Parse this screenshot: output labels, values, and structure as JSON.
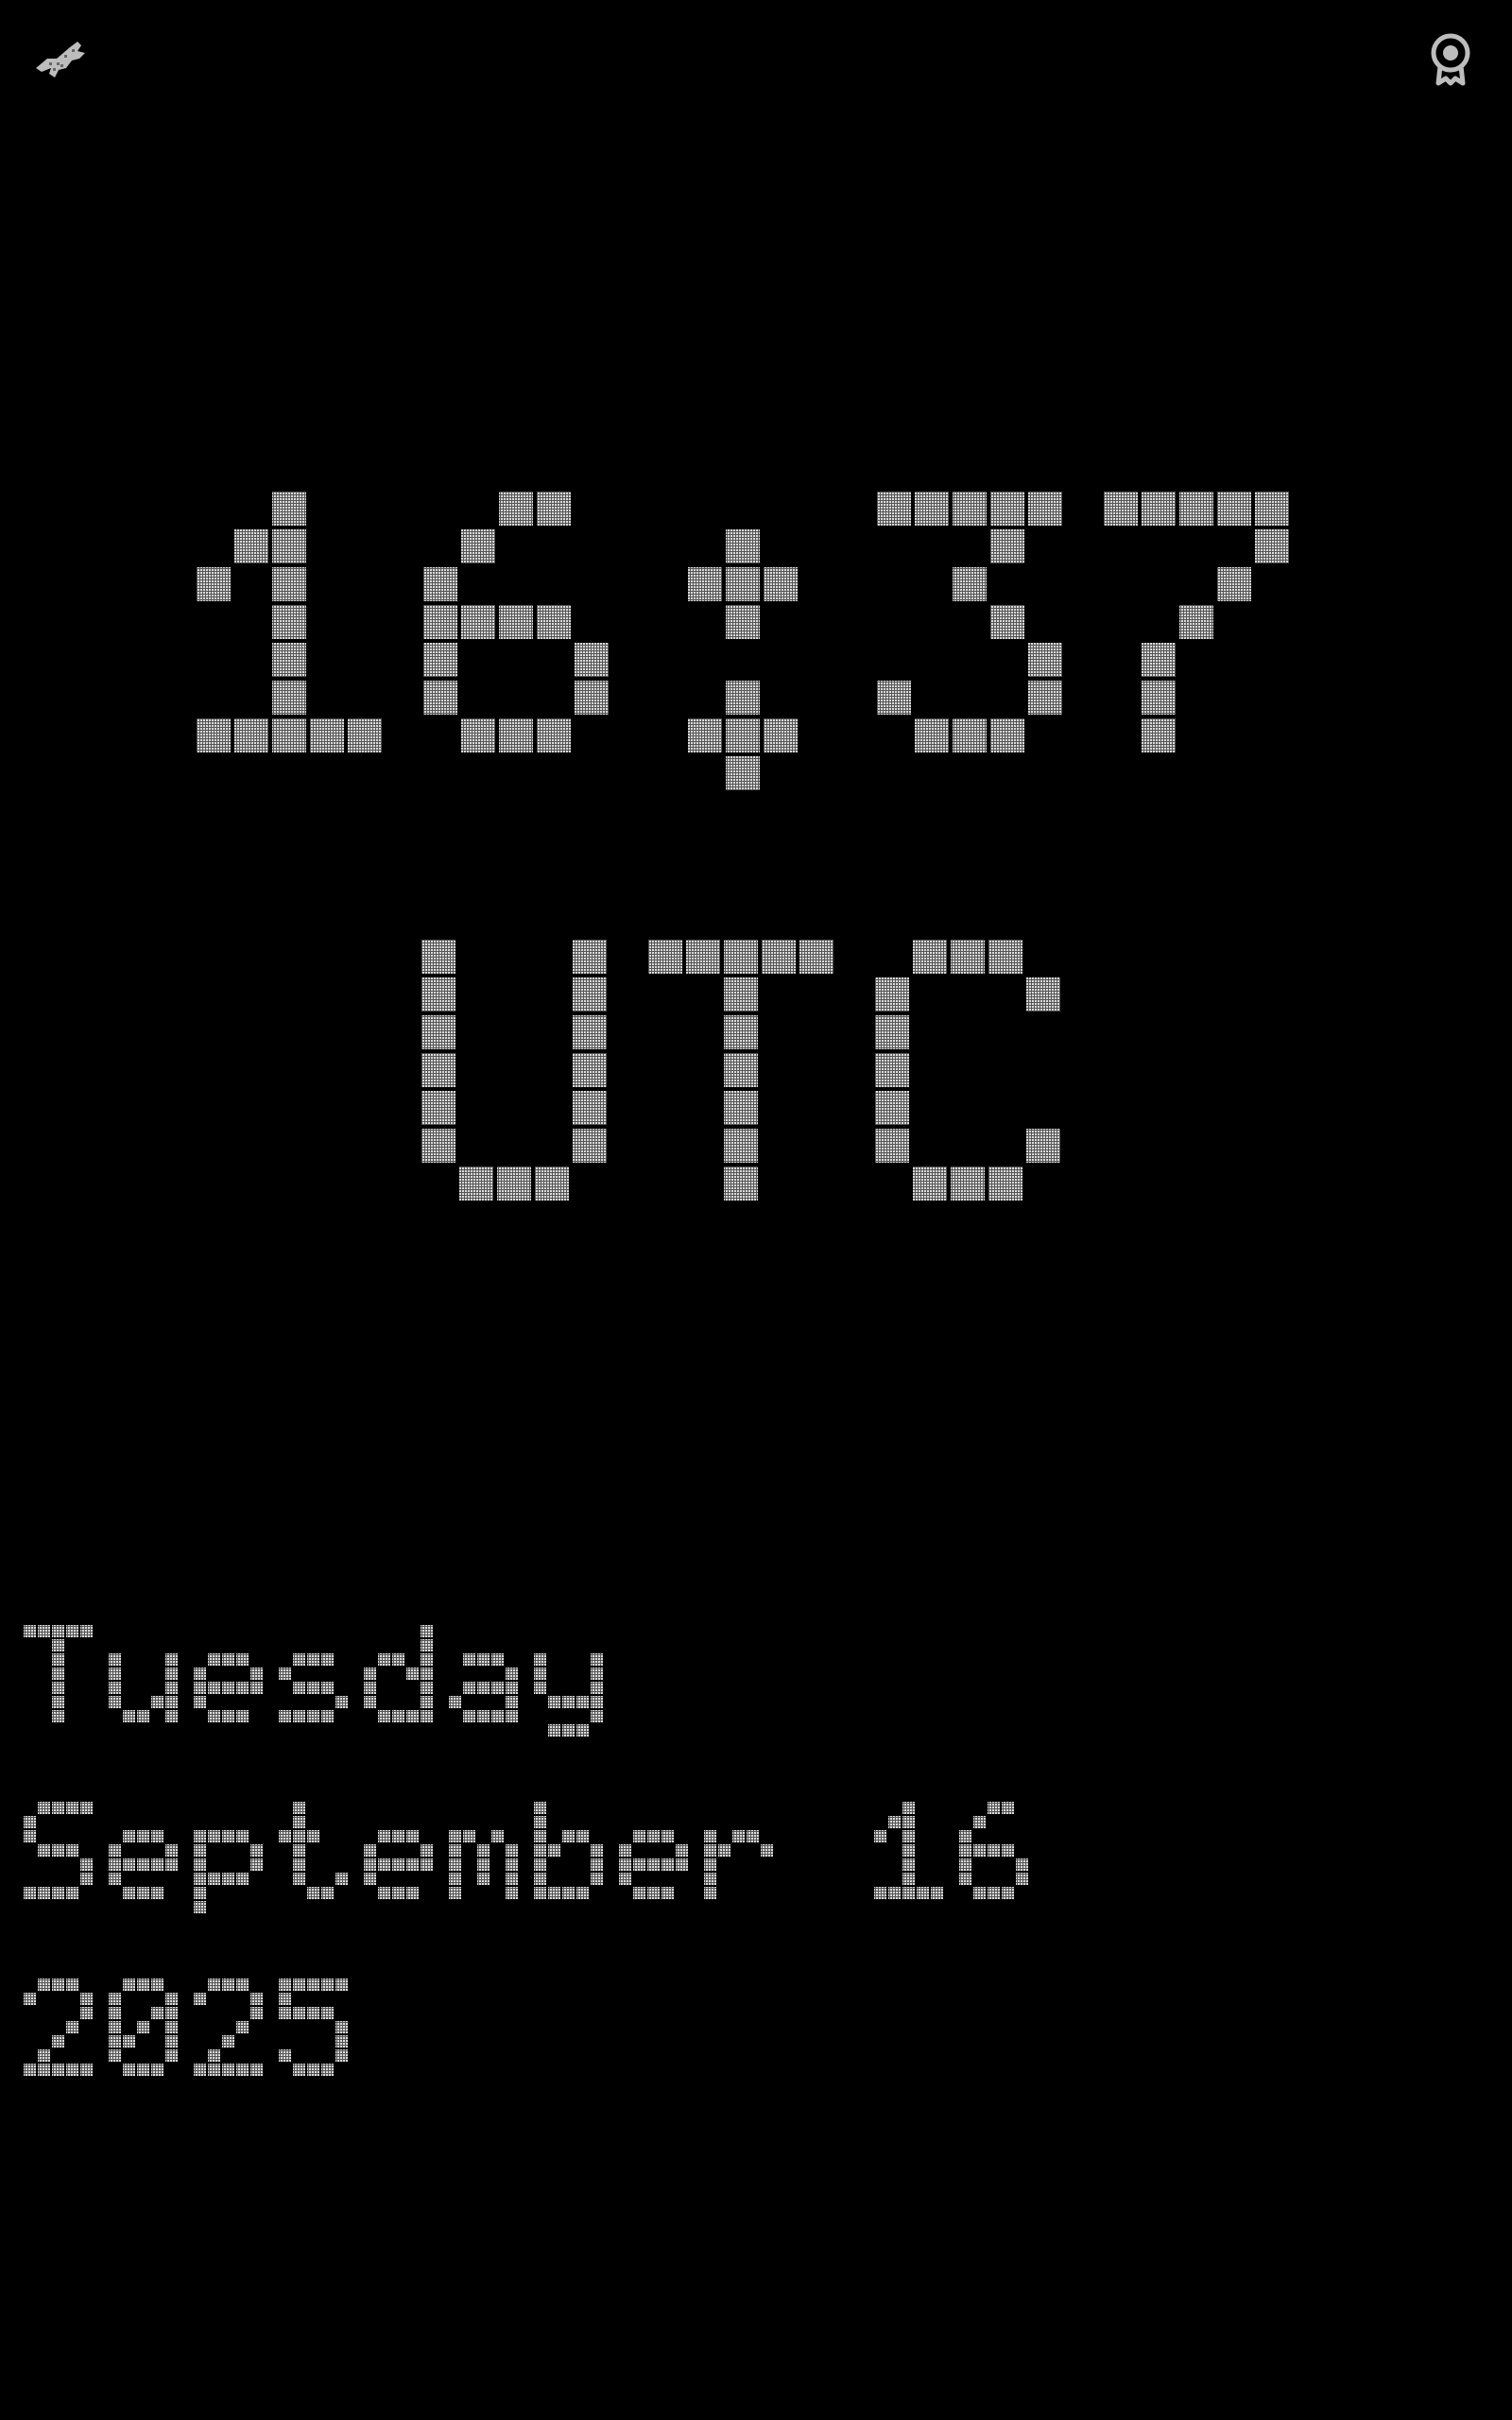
{
  "clock": {
    "time": "16:37",
    "zone": "UTC"
  },
  "date": {
    "weekday": "Tuesday",
    "month_day": "September 16",
    "year": "2025"
  },
  "colors": {
    "background": "#000000",
    "pixel": "#c8c8c8",
    "icon": "#bdbdbd"
  },
  "icons": {
    "left": "bird-icon",
    "right": "award-ribbon-icon"
  }
}
